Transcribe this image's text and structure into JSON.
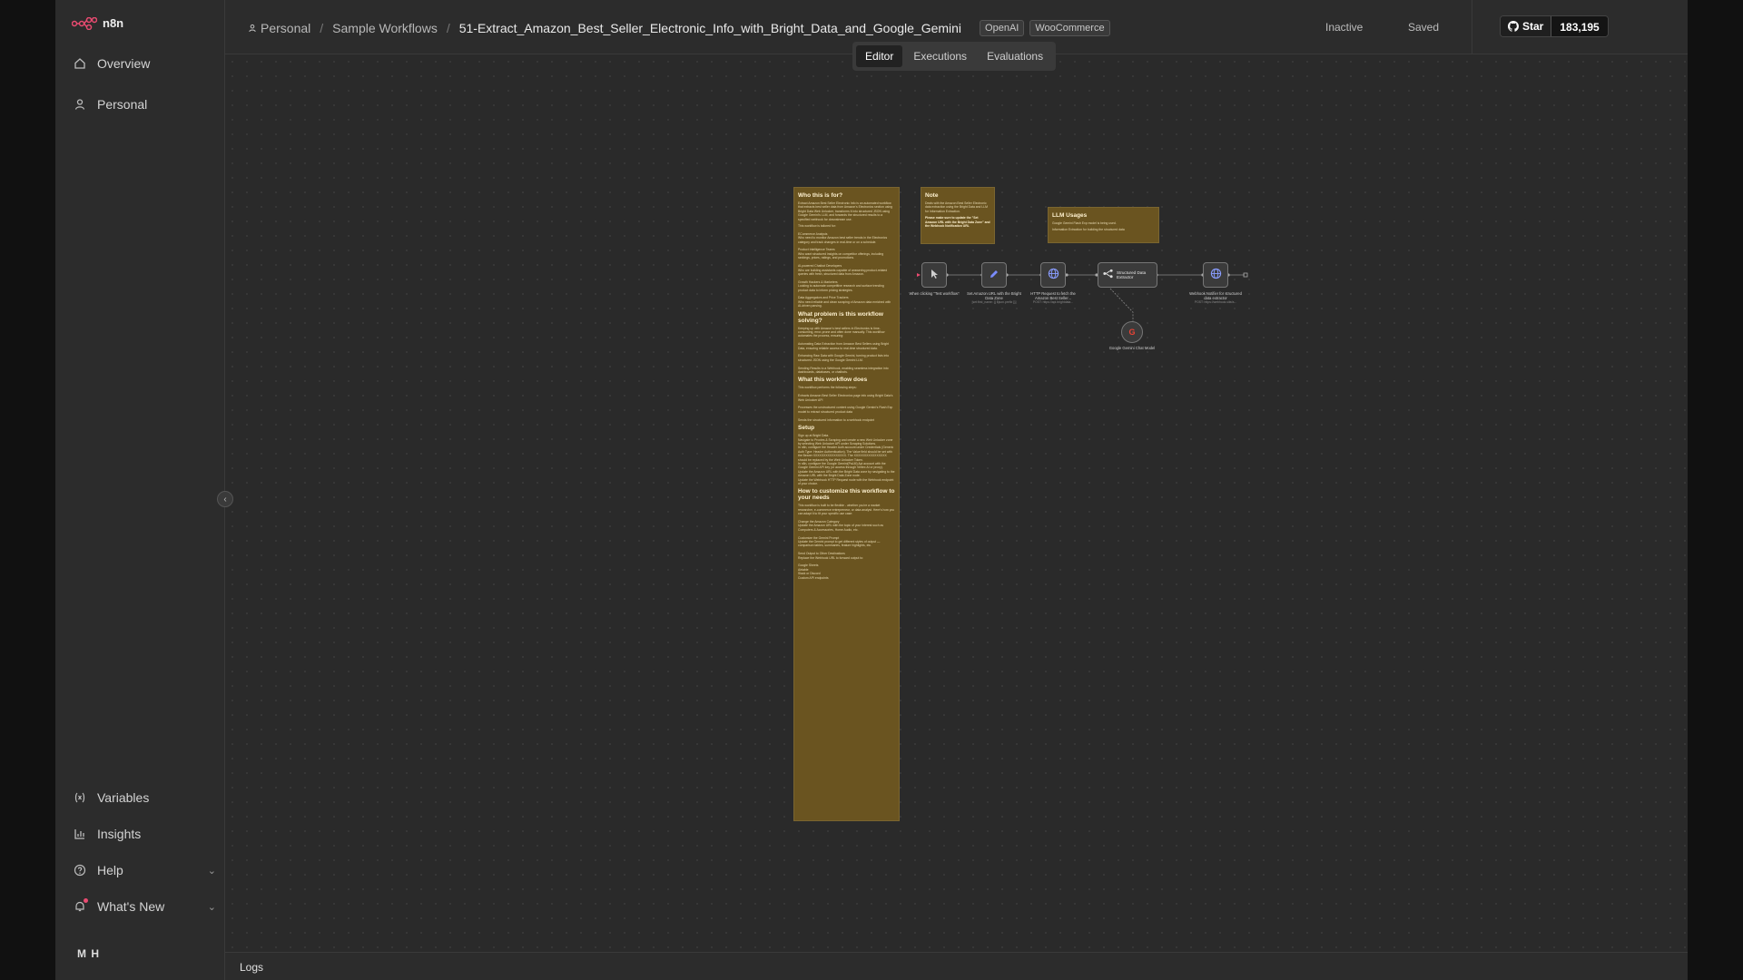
{
  "app": {
    "name": "n8n"
  },
  "sidebar": {
    "top_items": [
      {
        "label": "Overview",
        "icon": "home-icon"
      },
      {
        "label": "Personal",
        "icon": "user-icon"
      }
    ],
    "bottom_items": [
      {
        "label": "Variables",
        "icon": "variables-icon"
      },
      {
        "label": "Insights",
        "icon": "chart-icon"
      },
      {
        "label": "Help",
        "icon": "help-icon"
      },
      {
        "label": "What's New",
        "icon": "bell-icon"
      }
    ],
    "user_initials": "M H"
  },
  "header": {
    "breadcrumbs": [
      "Personal",
      "Sample Workflows"
    ],
    "workflow_title": "51-Extract_Amazon_Best_Seller_Electronic_Info_with_Bright_Data_and_Google_Gemini",
    "tags": [
      "OpenAI",
      "WooCommerce"
    ],
    "status": "Inactive",
    "save_state": "Saved",
    "github": {
      "star_label": "Star",
      "count": "183,195"
    }
  },
  "tabs": [
    "Editor",
    "Executions",
    "Evaluations"
  ],
  "logs_label": "Logs",
  "canvas": {
    "sticky_main": {
      "title1": "Who this is for?",
      "body1": "Extract Amazon Best Seller Electronic Info is an automated workflow that extracts best seller data from Amazon's Electronics section using Bright Data Web Unlocker, transforms it into structured JSON using Google Gemini's LLM, and forwards the structured results to a specified webhook for downstream use.",
      "body1b": "This workflow is tailored for:\n\nECommerce Analysts\nWho need to monitor Amazon best seller trends in the Electronics category and track changes in real-time or on a schedule.\n\nProduct Intelligence Teams\nWho want structured insights on competitor offerings, including rankings, prices, ratings, and promotions.\n\nAI-powered Chatbot Developers\nWho are building assistants capable of answering product-related queries with fresh, structured data from Amazon.\n\nGrowth Hackers & Marketers\nLooking to automate competitive research and surface trending product data to inform pricing strategies.\n\nData Aggregators and Price Trackers\nWho need reliable and clean scraping of Amazon data enriched with AI-driven parsing.",
      "title2": "What problem is this workflow solving?",
      "body2": "Keeping up with Amazon's best sellers in Electronics is time-consuming, error-prone and often done manually. This workflow automates the process, ensuring:\n\nAutomating Data Extraction from Amazon Best Sellers using Bright Data, ensuring reliable access to real-time structured data.\n\nEnhancing Raw Data with Google Gemini, turning product lists into structured JSON using the Google Gemini LLM.\n\nSending Results to a Webhook, enabling seamless integration into dashboards, databases, or chatbots.",
      "title3": "What this workflow does",
      "body3": "This workflow performs the following steps:\n\nExtracts Amazon Best Seller Electronics page info using Bright Data's Web Unlocker API\n\nProcesses the unstructured content using Google Gemini's Flash Exp model to extract structured product data\n\nSends the structured information to a webhook endpoint",
      "title4": "Setup",
      "body4": "Sign up at Bright Data.\nNavigate to Proxies & Scraping and create a new Web Unlocker zone by selecting Web Unlocker API under Scraping Solutions.\nIn n8n, configure the Header Auth account under Credentials (Generic Auth Type: Header Authentication). The Value field should be set with the Bearer XXXXXXXXXXXXXXXX. The XXXXXXXXXXXXXXXX should be replaced by the Web Unlocker Token.\nIn n8n, configure the Google Gemini(PaLM) Api account with the Google Gemini API key (or access through Vertex AI or proxy).\nUpdate the Amazon URL with the Bright Data zone by navigating to the Amazon URL with the Bright Data Zone node.\nUpdate the Webhook HTTP Request node with the Webhook endpoint of your choice.",
      "title5": "How to customize this workflow to your needs",
      "body5": "This workflow is built to be flexible - whether you're a market researcher, e-commerce entrepreneur, or data analyst. Here's how you can adapt it to fit your specific use case:\n\nChange the Amazon Category\nUpdate the Amazon URL with the topic of your interest such as Computers & Accessories, Home Audio, etc.\n\nCustomize the Gemini Prompt\nUpdate the Gemini prompt to get different styles of output — comparison tables, summaries, feature highlights, etc.\n\nSend Output to Other Destinations\nReplace the Webhook URL to forward output to:\n\nGoogle Sheets\nAirtable\nSlack or Discord\nCustom API endpoints"
    },
    "sticky_note": {
      "title": "Note",
      "body": "Deals with the Amazon Best Seller Electronic data extraction using the Bright Data and LLM for Information Extraction.",
      "bold": "Please make sure to update the \"Set Amazon URL with the Bright Data Zone\" and the Webhook Notification URL"
    },
    "sticky_llm": {
      "title": "LLM Usages",
      "body1": "Google Gemini Flash Exp model is being used.",
      "body2": "Information Extraction for building the structured data"
    },
    "nodes": [
      {
        "label": "When clicking \"Test workflow\"",
        "sub": "",
        "icon": "pointer-icon"
      },
      {
        "label": "Set Amazon URL with the Bright Data Zone",
        "sub": "[set:first_name: {{ $json.prefix }}]",
        "icon": "pencil-icon"
      },
      {
        "label": "HTTP Request to fetch the Amazon Best Seller...",
        "sub": "POST: https://api.brightdata...",
        "icon": "globe-icon"
      },
      {
        "label": "Structured Data Extractor",
        "sub": "",
        "icon": "extractor-icon"
      },
      {
        "label": "Webhook Notifier for structured data extractor",
        "sub": "POST: https://webhook.site/a...",
        "icon": "globe-icon"
      },
      {
        "label": "Google Gemini Chat Model",
        "sub": "",
        "icon": "google-icon"
      }
    ]
  }
}
